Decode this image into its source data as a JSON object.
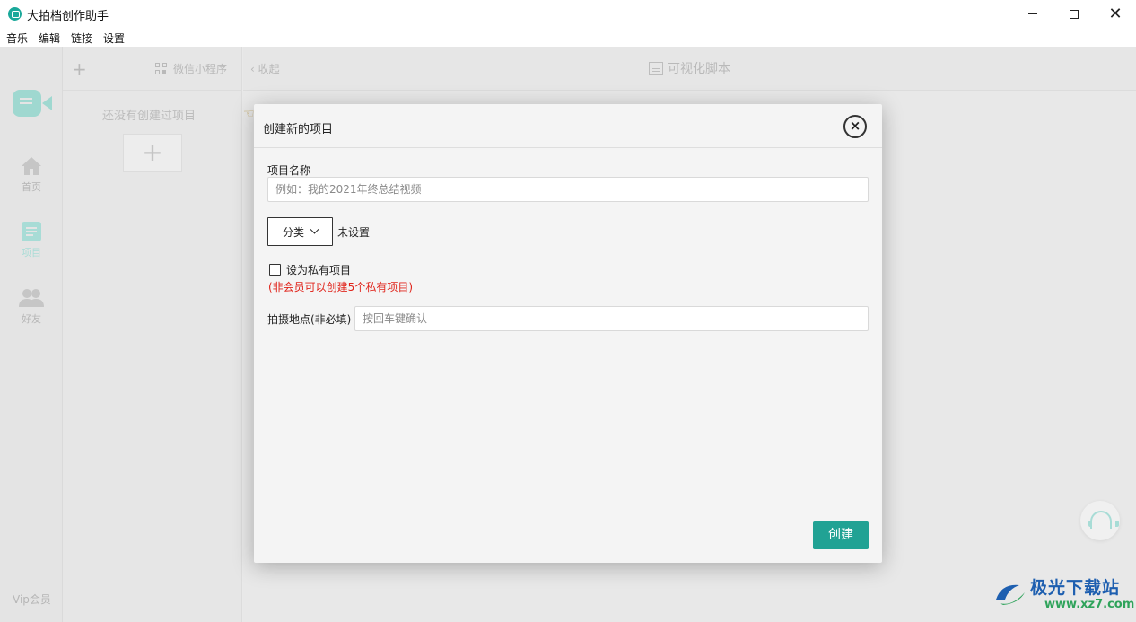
{
  "window": {
    "title": "大拍档创作助手",
    "controls": {
      "minimize": "—",
      "maximize": "☐",
      "close": "✕"
    }
  },
  "menu": [
    "音乐",
    "编辑",
    "链接",
    "设置"
  ],
  "leftnav": {
    "items": [
      {
        "label": "首页",
        "icon": "home-icon"
      },
      {
        "label": "项目",
        "icon": "document-icon"
      },
      {
        "label": "好友",
        "icon": "friends-icon"
      }
    ],
    "vip": "Vip会员"
  },
  "projects": {
    "add": "+",
    "miniapp": "微信小程序",
    "empty": "还没有创建过项目",
    "add_box": "+"
  },
  "main": {
    "collapse": "收起",
    "script": "可视化脚本"
  },
  "dialog": {
    "title": "创建新的项目",
    "close": "×",
    "name_label": "项目名称",
    "name_placeholder": "例如：我的2021年终总结视频",
    "category_button": "分类",
    "category_value": "未设置",
    "private_label": "设为私有项目",
    "private_note": "(非会员可以创建5个私有项目)",
    "location_label": "拍摄地点(非必填)",
    "location_placeholder": "按回车键确认",
    "create_button": "创建"
  },
  "watermark": {
    "brand": "极光下载站",
    "url": "www.xz7.com"
  },
  "colors": {
    "accent": "#21a294",
    "warning": "#e0241b"
  }
}
